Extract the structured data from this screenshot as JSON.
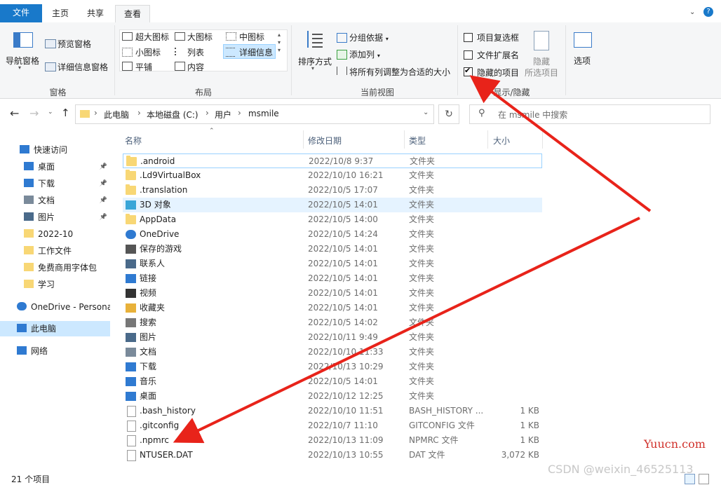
{
  "tabs": {
    "file": "文件",
    "home": "主页",
    "share": "共享",
    "view": "查看"
  },
  "ribbon": {
    "panes": {
      "nav_pane": "导航窗格",
      "preview_pane": "预览窗格",
      "details_pane": "详细信息窗格",
      "group_label": "窗格"
    },
    "layout": {
      "xlarge": "超大图标",
      "large": "大图标",
      "medium": "中图标",
      "small": "小图标",
      "list": "列表",
      "details": "详细信息",
      "tiles": "平铺",
      "content": "内容",
      "group_label": "布局"
    },
    "current_view": {
      "sort_by": "排序方式",
      "group_by": "分组依据",
      "add_columns": "添加列",
      "size_all": "将所有列调整为合适的大小",
      "group_label": "当前视图"
    },
    "show_hide": {
      "item_checkboxes": "项目复选框",
      "file_ext": "文件扩展名",
      "hidden_items": "隐藏的项目",
      "hide": "隐藏",
      "hide_selected": "所选项目",
      "options": "选项",
      "group_label": "显示/隐藏"
    },
    "checks": {
      "item_checkboxes": false,
      "file_ext": false,
      "hidden_items": true
    }
  },
  "address": {
    "crumbs": [
      "此电脑",
      "本地磁盘 (C:)",
      "用户",
      "msmile"
    ],
    "search_placeholder": "在 msmile 中搜索"
  },
  "nav": [
    {
      "label": "快速访问",
      "icon": "star-icon"
    },
    {
      "label": "桌面",
      "icon": "desktop-icon",
      "pinned": true
    },
    {
      "label": "下载",
      "icon": "download-icon",
      "pinned": true
    },
    {
      "label": "文档",
      "icon": "document-icon",
      "pinned": true
    },
    {
      "label": "图片",
      "icon": "picture-icon",
      "pinned": true
    },
    {
      "label": "2022-10",
      "icon": "folder-icon"
    },
    {
      "label": "工作文件",
      "icon": "folder-icon"
    },
    {
      "label": "免费商用字体包",
      "icon": "folder-icon"
    },
    {
      "label": "学习",
      "icon": "folder-icon"
    },
    {
      "label": "OneDrive - Persona",
      "icon": "cloud-icon"
    },
    {
      "label": "此电脑",
      "icon": "computer-icon"
    },
    {
      "label": "网络",
      "icon": "network-icon"
    }
  ],
  "columns": {
    "name": "名称",
    "date": "修改日期",
    "type": "类型",
    "size": "大小"
  },
  "files": [
    {
      "name": ".android",
      "date": "2022/10/8 9:37",
      "type": "文件夹",
      "size": "",
      "icon": "folder-icon"
    },
    {
      "name": ".Ld9VirtualBox",
      "date": "2022/10/10 16:21",
      "type": "文件夹",
      "size": "",
      "icon": "folder-icon"
    },
    {
      "name": ".translation",
      "date": "2022/10/5 17:07",
      "type": "文件夹",
      "size": "",
      "icon": "folder-icon"
    },
    {
      "name": "3D 对象",
      "date": "2022/10/5 14:01",
      "type": "文件夹",
      "size": "",
      "icon": "3d-objects-icon"
    },
    {
      "name": "AppData",
      "date": "2022/10/5 14:00",
      "type": "文件夹",
      "size": "",
      "icon": "folder-icon"
    },
    {
      "name": "OneDrive",
      "date": "2022/10/5 14:24",
      "type": "文件夹",
      "size": "",
      "icon": "cloud-icon"
    },
    {
      "name": "保存的游戏",
      "date": "2022/10/5 14:01",
      "type": "文件夹",
      "size": "",
      "icon": "games-icon"
    },
    {
      "name": "联系人",
      "date": "2022/10/5 14:01",
      "type": "文件夹",
      "size": "",
      "icon": "contacts-icon"
    },
    {
      "name": "链接",
      "date": "2022/10/5 14:01",
      "type": "文件夹",
      "size": "",
      "icon": "link-icon"
    },
    {
      "name": "视频",
      "date": "2022/10/5 14:01",
      "type": "文件夹",
      "size": "",
      "icon": "video-icon"
    },
    {
      "name": "收藏夹",
      "date": "2022/10/5 14:01",
      "type": "文件夹",
      "size": "",
      "icon": "favorites-icon"
    },
    {
      "name": "搜索",
      "date": "2022/10/5 14:02",
      "type": "文件夹",
      "size": "",
      "icon": "search-icon"
    },
    {
      "name": "图片",
      "date": "2022/10/11 9:49",
      "type": "文件夹",
      "size": "",
      "icon": "picture-icon"
    },
    {
      "name": "文档",
      "date": "2022/10/10 11:33",
      "type": "文件夹",
      "size": "",
      "icon": "document-icon"
    },
    {
      "name": "下载",
      "date": "2022/10/13 10:29",
      "type": "文件夹",
      "size": "",
      "icon": "download-icon"
    },
    {
      "name": "音乐",
      "date": "2022/10/5 14:01",
      "type": "文件夹",
      "size": "",
      "icon": "music-icon"
    },
    {
      "name": "桌面",
      "date": "2022/10/12 12:25",
      "type": "文件夹",
      "size": "",
      "icon": "desktop-icon"
    },
    {
      "name": ".bash_history",
      "date": "2022/10/10 11:51",
      "type": "BASH_HISTORY ...",
      "size": "1 KB",
      "icon": "file-icon"
    },
    {
      "name": ".gitconfig",
      "date": "2022/10/7 11:10",
      "type": "GITCONFIG 文件",
      "size": "1 KB",
      "icon": "file-icon"
    },
    {
      "name": ".npmrc",
      "date": "2022/10/13 11:09",
      "type": "NPMRC 文件",
      "size": "1 KB",
      "icon": "file-icon"
    },
    {
      "name": "NTUSER.DAT",
      "date": "2022/10/13 10:55",
      "type": "DAT 文件",
      "size": "3,072 KB",
      "icon": "file-icon"
    }
  ],
  "status": {
    "count": "21 个项目"
  },
  "watermarks": {
    "site": "Yuucn.com",
    "author": "CSDN @weixin_46525113"
  },
  "colors": {
    "accent": "#1979ca",
    "arrow": "#e8231a",
    "selected": "#cce8ff",
    "hover": "#e5f3ff"
  }
}
